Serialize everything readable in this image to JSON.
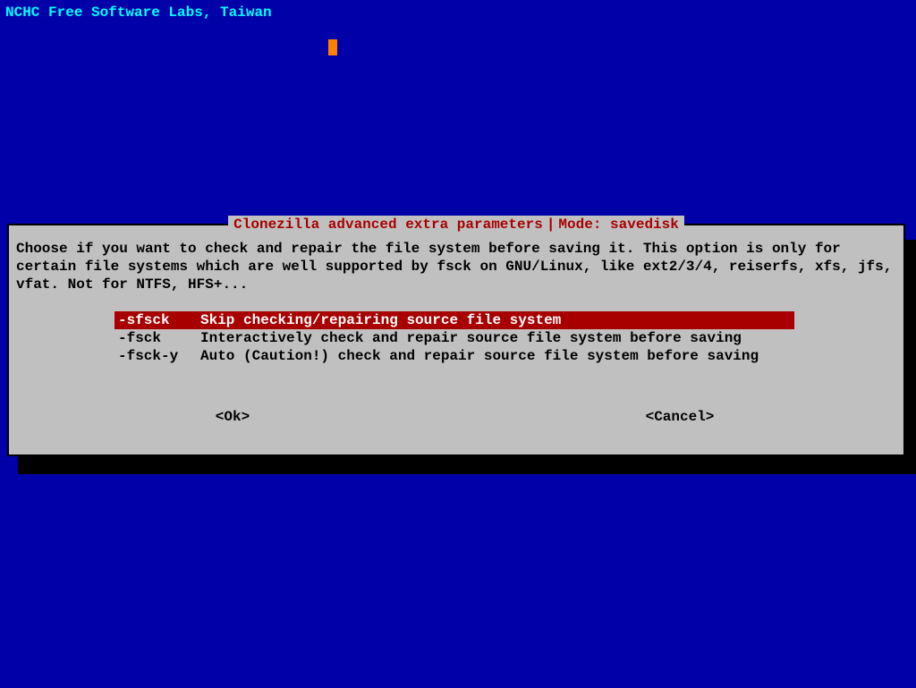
{
  "header": "NCHC Free Software Labs, Taiwan",
  "dialog": {
    "title_left": "Clonezilla advanced extra parameters",
    "title_right": "Mode: savedisk",
    "prompt": "Choose if you want to check and repair the file system before saving it. This option is only for certain file systems which are well supported by fsck on GNU/Linux, like ext2/3/4, reiserfs, xfs, jfs, vfat. Not for NTFS, HFS+...",
    "options": [
      {
        "key": "-sfsck",
        "desc": "Skip checking/repairing source file system",
        "selected": true
      },
      {
        "key": "-fsck",
        "desc": "Interactively check and repair source file system before saving",
        "selected": false
      },
      {
        "key": "-fsck-y",
        "desc": "Auto (Caution!) check and repair source file system before saving",
        "selected": false
      }
    ],
    "ok_label": "<Ok>",
    "cancel_label": "<Cancel>"
  }
}
